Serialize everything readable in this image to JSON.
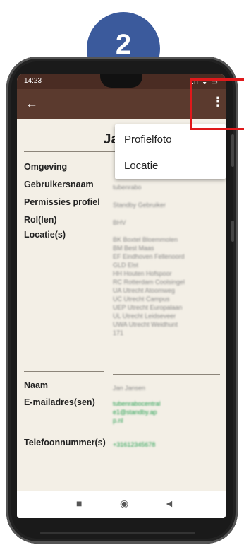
{
  "step_badge": "2",
  "status_bar": {
    "time": "14:23",
    "icons": ".ıl ᯤ ▭"
  },
  "app_bar": {
    "back_icon": "←",
    "more_icon": "⋮"
  },
  "profile": {
    "title": "Jan J"
  },
  "fields": [
    {
      "label": "Omgeving",
      "value": ""
    },
    {
      "label": "Gebruikersnaam",
      "value": "tubenrabo"
    },
    {
      "label": "Permissies profiel",
      "value": "Standby Gebruiker"
    },
    {
      "label": "Rol(len)",
      "value": "BHV"
    },
    {
      "label": "Locatie(s)",
      "value": "BK Boxtel Bloemmolen\nBM Best Maas\nEF Eindhoven Fellenoord\nGLD Elst\nHH Houten Hofspoor\nRC Rotterdam Coolsingel\nUA Utrecht Atoomweg\nUC Utrecht Campus\nUEP Utrecht Europalaan\nUL Utrecht Leidseveer\nUWA Utrecht Weidhunt\n171"
    },
    {
      "label": "Naam",
      "value": "Jan Jansen"
    },
    {
      "label": "E-mailadres(sen)",
      "value": "tubenrabocentrale1@standby.app.nl"
    },
    {
      "label": "Telefoonnummer(s)",
      "value": "+31612345678"
    }
  ],
  "menu": {
    "items": [
      "Profielfoto",
      "Locatie"
    ]
  },
  "nav_bar": {
    "square": "■",
    "circle": "◉",
    "back": "◄"
  },
  "colors": {
    "badge": "#3b5a9c",
    "app_bar": "#5b3a2e",
    "highlight": "#e0191b"
  }
}
